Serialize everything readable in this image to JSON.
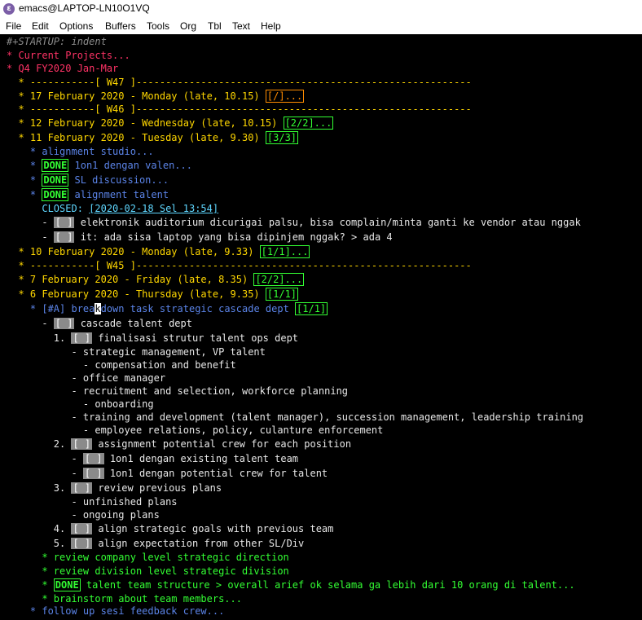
{
  "window": {
    "title": "emacs@LAPTOP-LN10O1VQ"
  },
  "menu": [
    "File",
    "Edit",
    "Options",
    "Buffers",
    "Tools",
    "Org",
    "Tbl",
    "Text",
    "Help"
  ],
  "buffer": {
    "l01": "#+STARTUP: indent",
    "l02": "* Current Projects...",
    "l03": "* Q4 FY2020 Jan-Mar",
    "l04": "  * -----------[ W47 ]---------------------------------------------------------",
    "l05a": "  * 17 February 2020 - Monday (late, 10.15) ",
    "l05b": "[/]...",
    "l06": "  * -----------[ W46 ]---------------------------------------------------------",
    "l07a": "  * 12 February 2020 - Wednesday (late, 10.15) ",
    "l07b": "[2/2]...",
    "l08a": "  * 11 February 2020 - Tuesday (late, 9.30) ",
    "l08b": "[3/3]",
    "l09": "    * alignment studio...",
    "l10a": "    * ",
    "l10b": "DONE",
    "l10c": " 1on1 dengan valen...",
    "l11a": "    * ",
    "l11b": "DONE",
    "l11c": " SL discussion...",
    "l12a": "    * ",
    "l12b": "DONE",
    "l12c": " alignment talent",
    "l13a": "      CLOSED: ",
    "l13b": "[2020-02-18 Sel 13:54]",
    "l14a": "      - ",
    "l14b": "[ ]",
    "l14c": " elektronik auditorium dicurigai palsu, bisa complain/minta ganti ke vendor atau nggak",
    "l15a": "      - ",
    "l15b": "[ ]",
    "l15c": " it: ada sisa laptop yang bisa dipinjem nggak? > ada 4",
    "l16a": "  * 10 February 2020 - Monday (late, 9.33) ",
    "l16b": "[1/1]...",
    "l17": "  * -----------[ W45 ]---------------------------------------------------------",
    "l18a": "  * 7 February 2020 - Friday (late, 8.35) ",
    "l18b": "[2/2]...",
    "l19a": "  * 6 February 2020 - Thursday (late, 9.35) ",
    "l19b": "[1/1]",
    "l20a": "    * [#A] brea",
    "l20b": "k",
    "l20c": "down task strategic cascade dept ",
    "l20d": "[1/1]",
    "l21a": "      - ",
    "l21b": "[ ]",
    "l21c": " cascade talent dept",
    "l22a": "        1. ",
    "l22b": "[ ]",
    "l22c": " finalisasi strutur talent ops dept",
    "l23": "           - strategic management, VP talent",
    "l24": "             - compensation and benefit",
    "l25": "           - office manager",
    "l26": "           - recruitment and selection, workforce planning",
    "l27": "             - onboarding",
    "l28": "           - training and development (talent manager), succession management, leadership training",
    "l29": "             - employee relations, policy, culanture enforcement",
    "l30a": "        2. ",
    "l30b": "[ ]",
    "l30c": " assignment potential crew for each position",
    "l31a": "           - ",
    "l31b": "[ ]",
    "l31c": " 1on1 dengan existing talent team",
    "l32a": "           - ",
    "l32b": "[ ]",
    "l32c": " 1on1 dengan potential crew for talent",
    "l33a": "        3. ",
    "l33b": "[ ]",
    "l33c": " review previous plans",
    "l34": "           - unfinished plans",
    "l35": "           - ongoing plans",
    "l36a": "        4. ",
    "l36b": "[ ]",
    "l36c": " align strategic goals with previous team",
    "l37a": "        5. ",
    "l37b": "[ ]",
    "l37c": " align expectation from other SL/Div",
    "l38": "      * review company level strategic direction",
    "l39": "      * review division level strategic division",
    "l40a": "      * ",
    "l40b": "DONE",
    "l40c": " talent team structure > overall arief ok selama ga lebih dari 10 orang di talent...",
    "l41": "      * brainstorm about team members...",
    "l42": "    * follow up sesi feedback crew..."
  }
}
